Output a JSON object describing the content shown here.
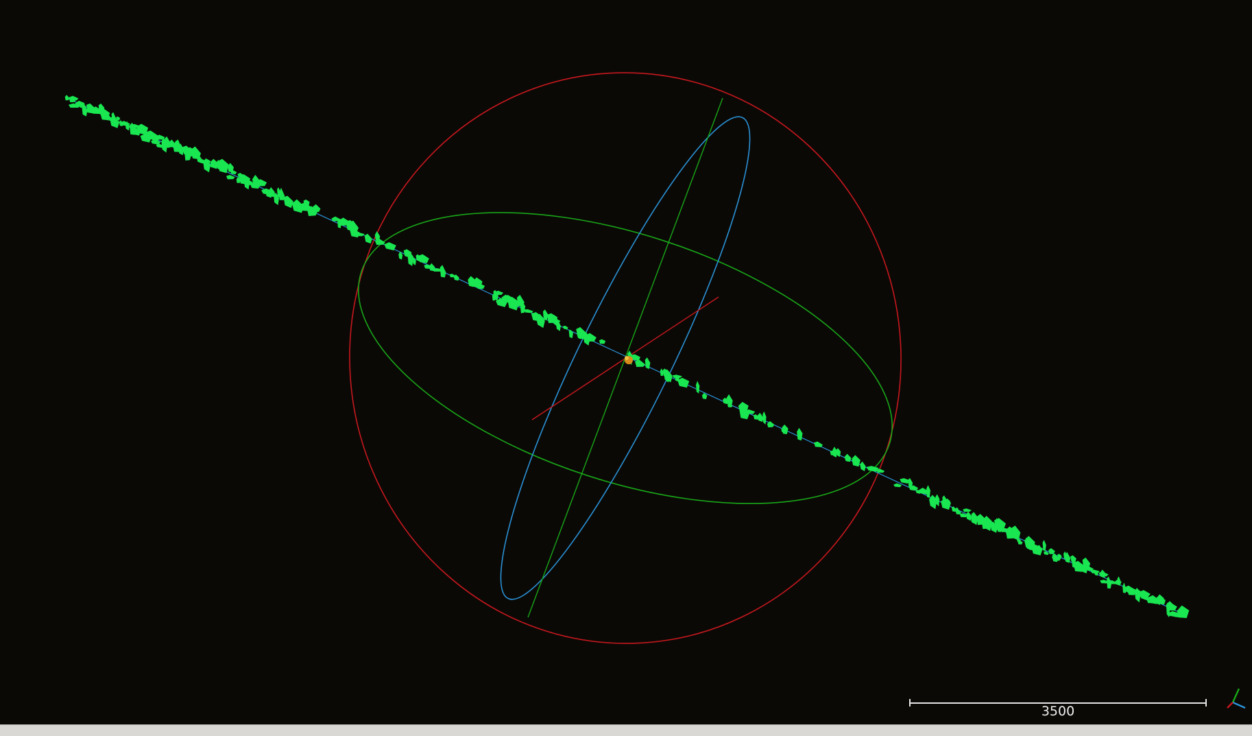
{
  "viewer": {
    "background_color": "#0b0906",
    "scale_bar": {
      "label": "3500"
    },
    "colors": {
      "particles": "#19e650",
      "ellipse_x": "#c8181e",
      "ellipse_y": "#18a818",
      "ellipse_z": "#2a92d6",
      "center_marker": "#d88a1a"
    },
    "icons": {
      "orientation_axes": "xyz-axes-icon"
    }
  }
}
